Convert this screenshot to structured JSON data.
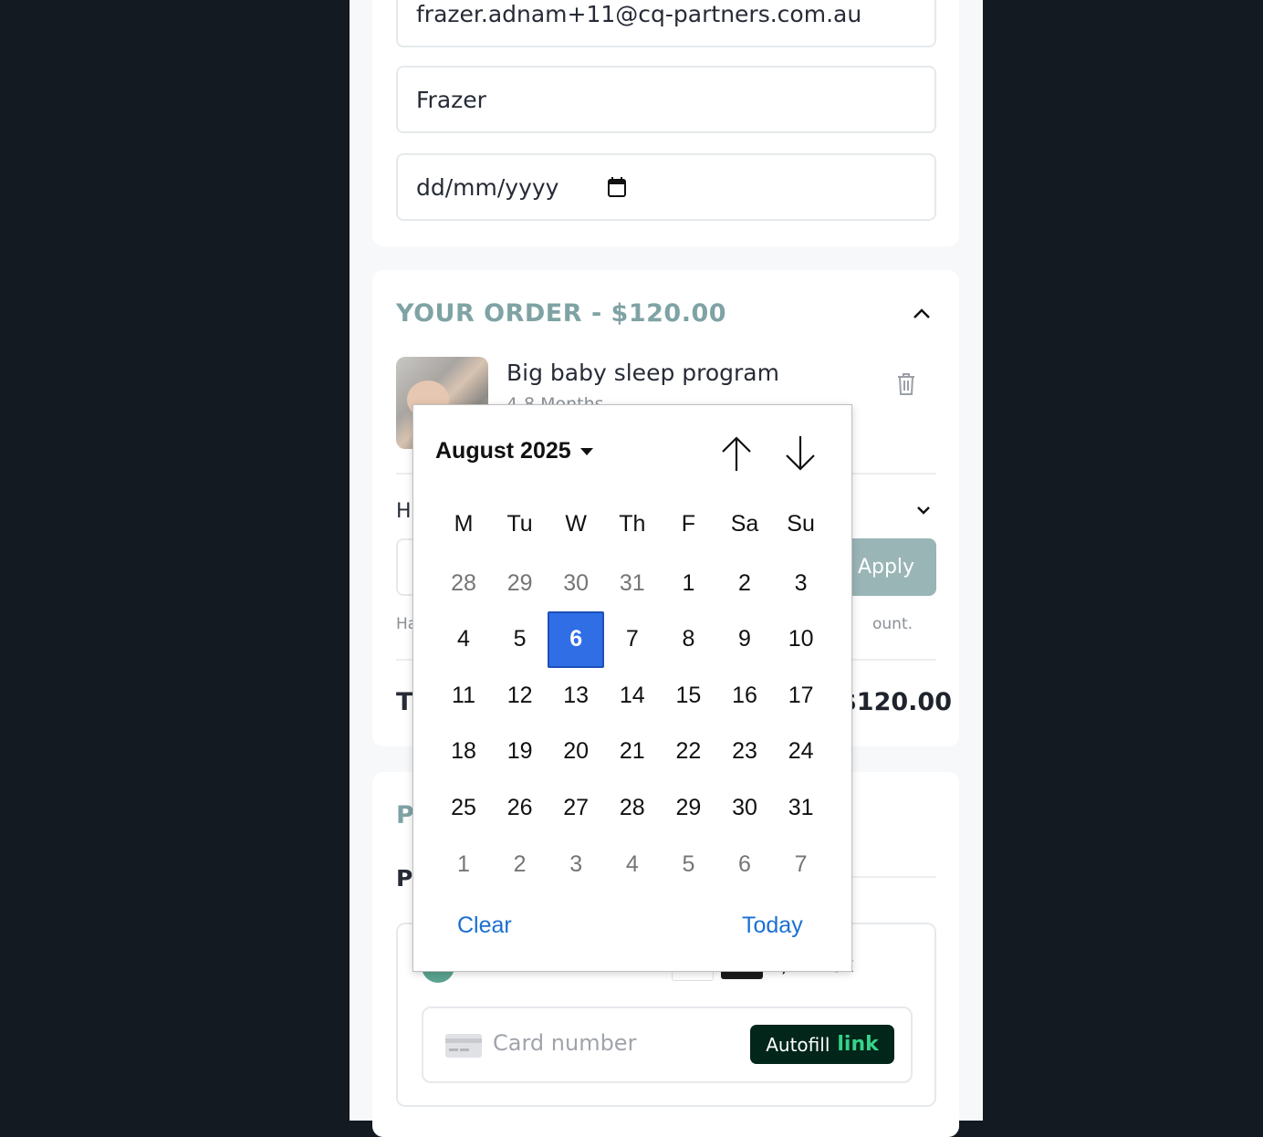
{
  "form": {
    "email": "frazer.adnam+11@cq-partners.com.au",
    "first_name": "Frazer",
    "dob_placeholder": "dd/mm/yyyy"
  },
  "order": {
    "title": "YOUR ORDER - $120.00",
    "product_name": "Big baby sleep program",
    "product_variant": "4-8 Months",
    "coupon_toggle_letter": "H",
    "apply_label": "Apply",
    "note_left": "Ha",
    "note_right": "ount.",
    "total_label_partial": "T",
    "total_value": "$120.00"
  },
  "payment": {
    "section_letter": "P",
    "method_letter": "P",
    "card_types_partial": "B, Amex",
    "card_number_placeholder": "Card number",
    "autofill_label": "Autofill",
    "autofill_link": "link"
  },
  "datepicker": {
    "month_label": "August 2025",
    "weekdays": [
      "M",
      "Tu",
      "W",
      "Th",
      "F",
      "Sa",
      "Su"
    ],
    "weeks": [
      [
        "28",
        "29",
        "30",
        "31",
        "1",
        "2",
        "3"
      ],
      [
        "4",
        "5",
        "6",
        "7",
        "8",
        "9",
        "10"
      ],
      [
        "11",
        "12",
        "13",
        "14",
        "15",
        "16",
        "17"
      ],
      [
        "18",
        "19",
        "20",
        "21",
        "22",
        "23",
        "24"
      ],
      [
        "25",
        "26",
        "27",
        "28",
        "29",
        "30",
        "31"
      ],
      [
        "1",
        "2",
        "3",
        "4",
        "5",
        "6",
        "7"
      ]
    ],
    "selected_day": "6",
    "clear_label": "Clear",
    "today_label": "Today"
  }
}
